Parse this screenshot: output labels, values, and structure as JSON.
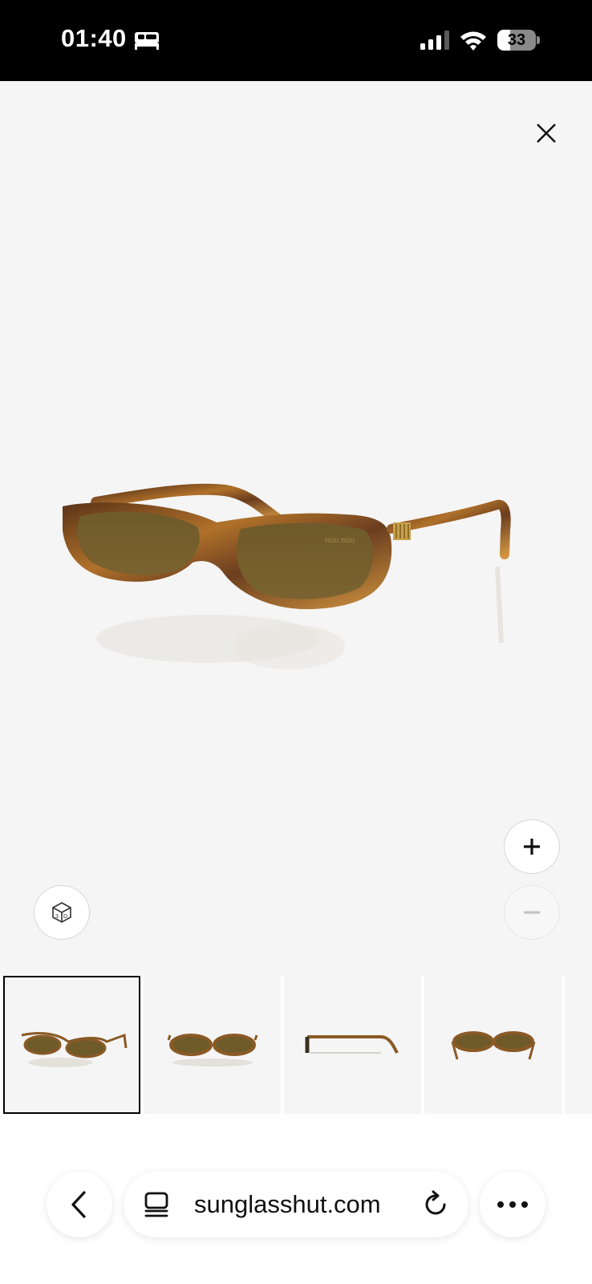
{
  "status_bar": {
    "time": "01:40",
    "battery_level": "33",
    "battery_fraction": 0.33,
    "icons": [
      "sleep-focus-icon",
      "cellular-signal-icon",
      "wifi-icon",
      "battery-icon"
    ]
  },
  "viewer": {
    "close_icon": "close-icon",
    "zoom_in_icon": "plus-icon",
    "zoom_out_icon": "minus-icon",
    "view_3d_icon": "3d-cube-icon",
    "product_brand_mark": "miu miu",
    "colors": {
      "background": "#f5f5f5",
      "frame_tortoise_dark": "#6b3e1f",
      "frame_tortoise_light": "#c8862e",
      "lens": "#6f5a2a"
    }
  },
  "thumbnails": {
    "selected_index": 0,
    "items": [
      "angle-view",
      "front-view",
      "side-view",
      "back-view",
      "detail-view"
    ]
  },
  "browser_bar": {
    "url": "sunglasshut.com",
    "back_icon": "chevron-left-icon",
    "tabs_icon": "tab-overview-icon",
    "reload_icon": "reload-icon",
    "more_icon": "more-horizontal-icon"
  }
}
